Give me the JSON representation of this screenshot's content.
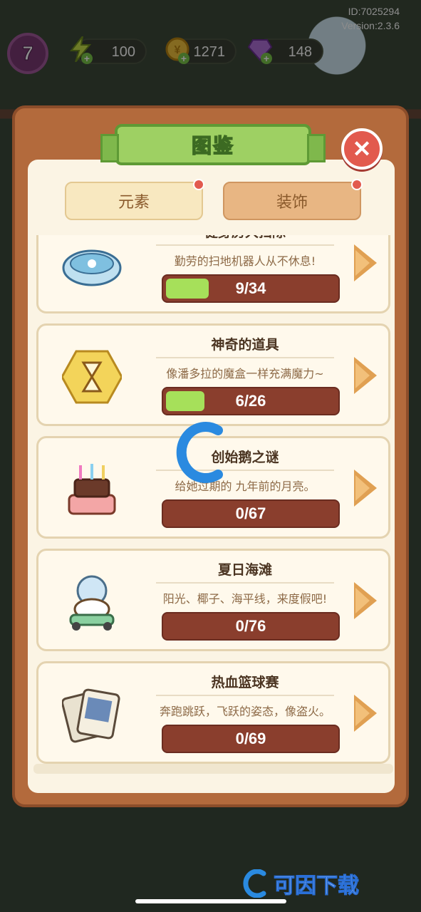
{
  "hud": {
    "level": "7",
    "energy": "100",
    "coins": "1271",
    "gems": "148",
    "id_label": "ID:7025294",
    "version_label": "Version:2.3.6"
  },
  "dialog": {
    "title": "图鉴",
    "tabs": [
      {
        "label": "元素",
        "selected": true,
        "has_notification": true
      },
      {
        "label": "装饰",
        "selected": false,
        "has_notification": true
      }
    ]
  },
  "collections": [
    {
      "name": "健身房大扫除",
      "description": "勤劳的扫地机器人从不休息!",
      "progress": "9/34",
      "fraction": 0.2647,
      "icon": "robot-vacuum-icon"
    },
    {
      "name": "神奇的道具",
      "description": "像潘多拉的魔盒一样充满魔力~",
      "progress": "6/26",
      "fraction": 0.2308,
      "icon": "hourglass-icon"
    },
    {
      "name": "创始鹅之谜",
      "description": "给她过期的 九年前的月亮。",
      "progress": "0/67",
      "fraction": 0,
      "icon": "cake-icon"
    },
    {
      "name": "夏日海滩",
      "description": "阳光、椰子、海平线，来度假吧!",
      "progress": "0/76",
      "fraction": 0,
      "icon": "goose-scooter-icon"
    },
    {
      "name": "热血篮球赛",
      "description": "奔跑跳跃，飞跃的姿态，像盗火。",
      "progress": "0/69",
      "fraction": 0,
      "icon": "photo-cards-icon"
    }
  ],
  "watermark": {
    "brand_text": "可因下载"
  },
  "colors": {
    "panel": "#b36a3c",
    "banner": "#9ed063",
    "progress_fill": "#a6e05a",
    "progress_track": "#8a3e2d",
    "close": "#e25a4e"
  }
}
